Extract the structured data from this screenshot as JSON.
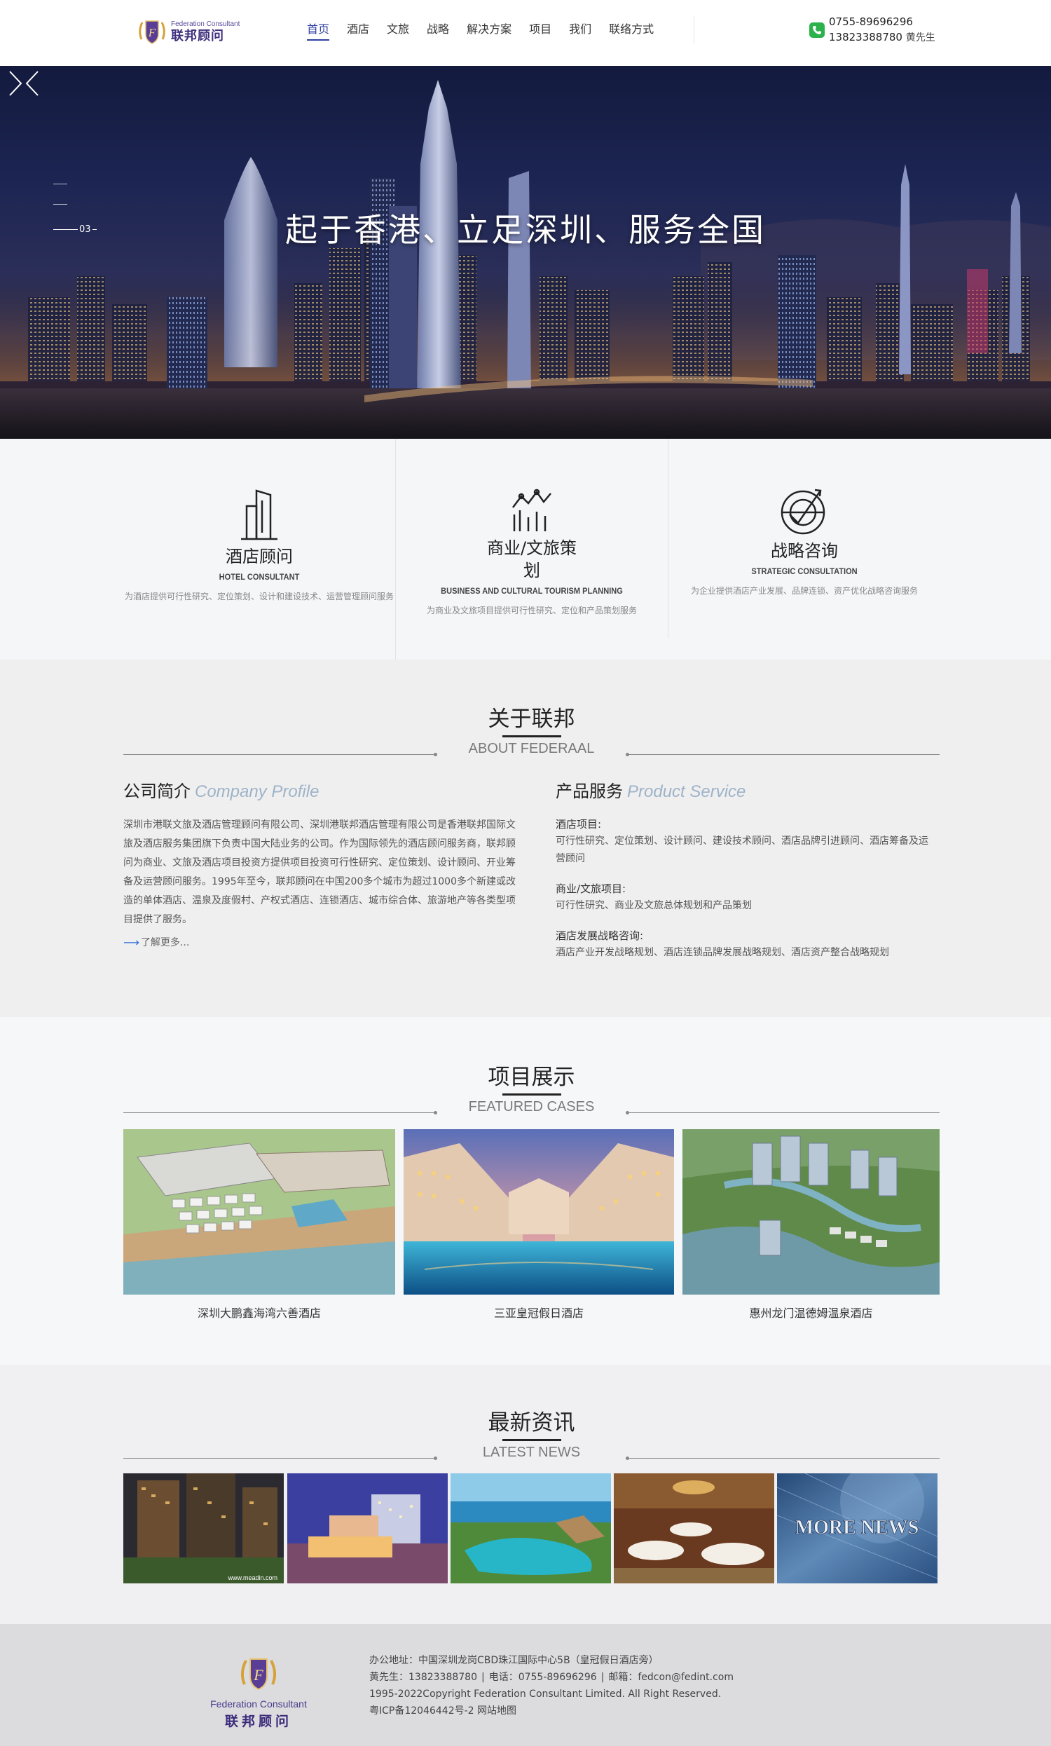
{
  "header": {
    "logo_en": "Federation Consultant",
    "logo_cn": "联邦顾问",
    "nav": [
      "首页",
      "酒店",
      "文旅",
      "战略",
      "解决方案",
      "项目",
      "我们",
      "联络方式"
    ],
    "active_nav": "首页",
    "phone": "0755-89696296",
    "mobile": "13823388780",
    "contact_name": "黄先生"
  },
  "hero": {
    "title": "起于香港、立足深圳、服务全国",
    "slide_number": "03"
  },
  "services": [
    {
      "title": "酒店顾问",
      "title_line2": "",
      "en": "HOTEL CONSULTANT",
      "desc": "为酒店提供可行性研究、定位策划、设计和建设技术、运营管理顾问服务",
      "icon": "building-icon"
    },
    {
      "title": "商业/文旅策",
      "title_line2": "划",
      "en": "BUSINESS AND CULTURAL TOURISM PLANNING",
      "desc": "为商业及文旅项目提供可行性研究、定位和产品策划服务",
      "icon": "chart-icon"
    },
    {
      "title": "战略咨询",
      "title_line2": "",
      "en": "STRATEGIC CONSULTATION",
      "desc": "为企业提供酒店产业发展、品牌连锁、资产优化战略咨询服务",
      "icon": "target-icon"
    }
  ],
  "about": {
    "title": "关于联邦",
    "title_en": "ABOUT FEDERAAL",
    "profile_head": "公司简介",
    "profile_head_en": "Company Profile",
    "profile_text": "深圳市港联文旅及酒店管理顾问有限公司、深圳港联邦酒店管理有限公司是香港联邦国际文旅及酒店服务集团旗下负责中国大陆业务的公司。作为国际领先的酒店顾问服务商，联邦顾问为商业、文旅及酒店项目投资方提供项目投资可行性研究、定位策划、设计顾问、开业筹备及运营顾问服务。1995年至今，联邦顾问在中国200多个城市为超过1000多个新建或改造的单体酒店、温泉及度假村、产权式酒店、连锁酒店、城市综合体、旅游地产等各类型项目提供了服务。",
    "more": "了解更多...",
    "service_head": "产品服务",
    "service_head_en": "Product Service",
    "service_items": [
      {
        "label": "酒店项目:",
        "desc": "可行性研究、定位策划、设计顾问、建设技术顾问、酒店品牌引进顾问、酒店筹备及运营顾问"
      },
      {
        "label": "商业/文旅项目:",
        "desc": "可行性研究、商业及文旅总体规划和产品策划"
      },
      {
        "label": "酒店发展战略咨询:",
        "desc": "酒店产业开发战略规划、酒店连锁品牌发展战略规划、酒店资产整合战略规划"
      }
    ]
  },
  "projects": {
    "title": "项目展示",
    "title_en": "FEATURED CASES",
    "items": [
      "深圳大鹏鑫海湾六善酒店",
      "三亚皇冠假日酒店",
      "惠州龙门温德姆温泉酒店"
    ]
  },
  "news": {
    "title": "最新资讯",
    "title_en": "LATEST NEWS",
    "watermark": "www.meadin.com",
    "more_news": "MORE NEWS"
  },
  "footer": {
    "logo_en": "Federation Consultant",
    "logo_cn": "联邦顾问",
    "address": "办公地址：中国深圳龙岗CBD珠江国际中心5B（皇冠假日酒店旁）",
    "contact_person": "黄先生：13823388780",
    "tel": "电话：0755-89696296",
    "email": "邮箱：fedcon@fedint.com",
    "copyright": "1995-2022Copyright Federation Consultant Limited. All Right Reserved.",
    "icp": "粤ICP备12046442号-2",
    "sitemap": "网站地图"
  },
  "colors": {
    "nav_active": "#2f3fa0",
    "brand_purple": "#3f2f7f",
    "accent_blue": "#2b6ed8",
    "phone_green": "#2bb24c"
  }
}
